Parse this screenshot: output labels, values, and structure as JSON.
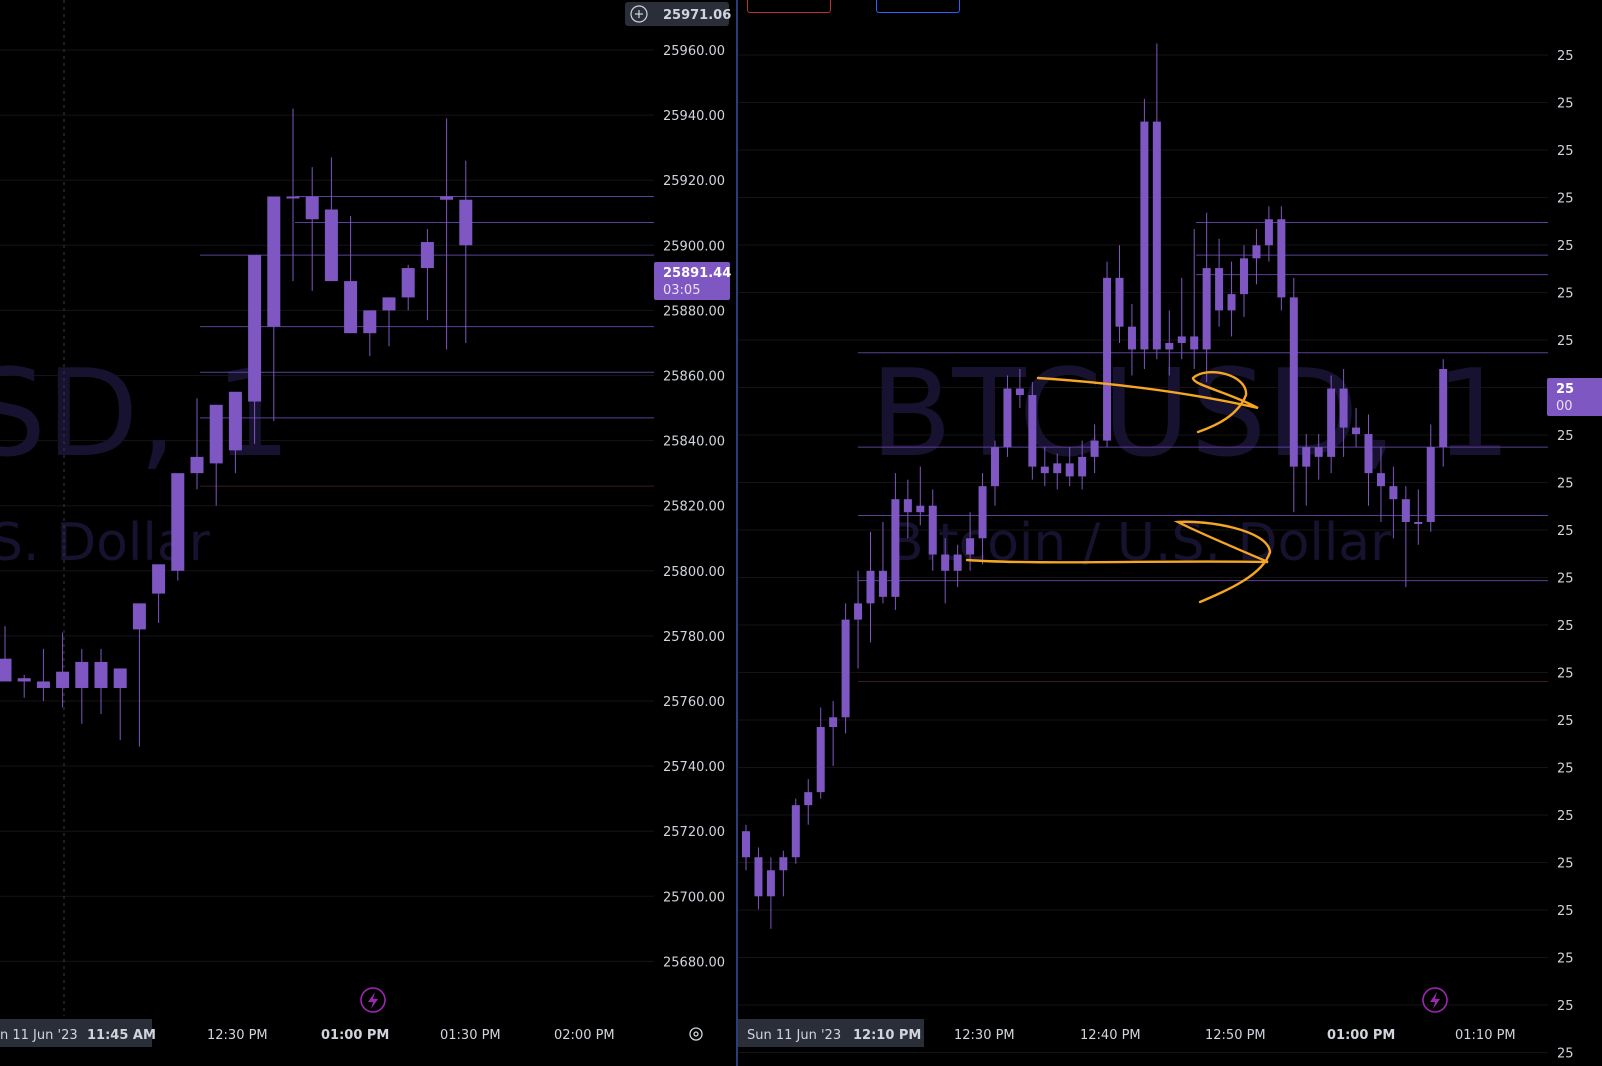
{
  "colors": {
    "up": "#7e57c2",
    "down": "#7e57c2",
    "level": "#5b3f99",
    "level_dark": "#3a1a2e",
    "grid": "#141414",
    "annotation": "#f5a623",
    "price_tag": "#7e57c2",
    "watermark": "#17122f"
  },
  "left": {
    "watermark_symbol": "SD, 1",
    "watermark_desc": "S. Dollar",
    "top_price": "25971.06",
    "last_price": "25891.44",
    "countdown": "03:05",
    "price_ticks": [
      "25960.00",
      "25940.00",
      "25920.00",
      "25900.00",
      "25880.00",
      "25860.00",
      "25840.00",
      "25820.00",
      "25800.00",
      "25780.00",
      "25760.00",
      "25740.00",
      "25720.00",
      "25700.00",
      "25680.00"
    ],
    "time_ticks": {
      "date_box": "n 11 Jun '23",
      "crosshair_time": "11:45 AM",
      "t1": "12:30 PM",
      "t2": "01:00 PM",
      "t3": "01:30 PM",
      "t4": "02:00 PM"
    },
    "levels": [
      25915,
      25907,
      25897,
      25875,
      25861,
      25847,
      25826
    ],
    "icons": {
      "add": "plus-circle-icon",
      "replay": "lightning-icon",
      "settings": "gear-icon"
    }
  },
  "right": {
    "watermark_symbol": "BTCUSD, 1",
    "watermark_desc": "Bitcoin / U.S. Dollar",
    "price_tag_main": "25",
    "price_tag_sub": "00",
    "price_ticks_partial": [
      "25",
      "25",
      "25",
      "25",
      "25",
      "25",
      "25",
      "25",
      "25",
      "25",
      "25",
      "25",
      "25",
      "25",
      "25",
      "25",
      "25",
      "25",
      "25",
      "25",
      "25",
      "25"
    ],
    "time_ticks": {
      "date_box": "Sun 11 Jun '23",
      "crosshair_time": "12:10 PM",
      "t1": "12:30 PM",
      "t2": "12:40 PM",
      "t3": "12:50 PM",
      "t4": "01:00 PM",
      "t5": "01:10 PM"
    },
    "levels": [
      25907,
      25897,
      25891,
      25867,
      25838,
      25817,
      25797,
      25766
    ],
    "icons": {
      "replay": "lightning-icon"
    }
  },
  "chart_data": [
    {
      "type": "candlestick",
      "title": "",
      "interval": "5m",
      "ylim": [
        25665,
        25985
      ],
      "x": [
        "11:05",
        "11:10",
        "11:15",
        "11:20",
        "11:25",
        "11:30",
        "11:35",
        "11:40",
        "11:45",
        "11:50",
        "11:55",
        "12:00",
        "12:05",
        "12:10",
        "12:15",
        "12:20",
        "12:25",
        "12:30",
        "12:35",
        "12:40",
        "12:45",
        "12:50",
        "12:55",
        "13:00",
        "13:05"
      ],
      "open": [
        25773,
        25767,
        25766,
        25769,
        25764,
        25772,
        25764,
        25782,
        25793,
        25800,
        25830,
        25833,
        25837,
        25852,
        25875,
        25915,
        25915,
        25911,
        25889,
        25873,
        25880,
        25884,
        25893,
        25914,
        25914
      ],
      "high": [
        25783,
        25768,
        25776,
        25781,
        25776,
        25776,
        25769,
        25783,
        25797,
        25808,
        25853,
        25846,
        25850,
        25858,
        25901,
        25942,
        25924,
        25927,
        25909,
        25880,
        25884,
        25894,
        25905,
        25939,
        25926
      ],
      "low": [
        25768,
        25761,
        25760,
        25758,
        25753,
        25756,
        25748,
        25746,
        25784,
        25797,
        25825,
        25820,
        25830,
        25839,
        25846,
        25889,
        25886,
        25897,
        25874,
        25866,
        25869,
        25880,
        25877,
        25868,
        25870
      ],
      "close": [
        25766,
        25766,
        25764,
        25764,
        25772,
        25764,
        25770,
        25790,
        25802,
        25830,
        25835,
        25851,
        25855,
        25897,
        25915,
        25915,
        25908,
        25889,
        25873,
        25880,
        25884,
        25893,
        25901,
        25915,
        25900
      ]
    },
    {
      "type": "candlestick",
      "title": "BTCUSD, 1",
      "interval": "1m",
      "ylim": [
        25665,
        25985
      ]
    }
  ]
}
